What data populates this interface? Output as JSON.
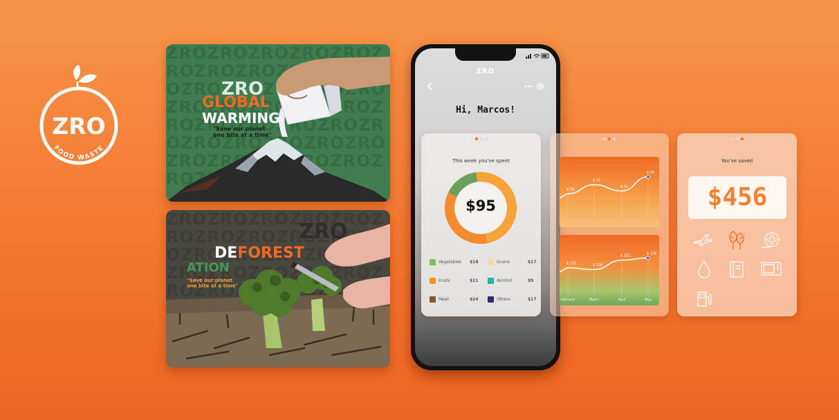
{
  "logo": {
    "brand": "ZRO",
    "tagline": "FOOD WASTE",
    "colors": {
      "ring": "#ffffff",
      "background": "#f4782e"
    }
  },
  "posters": [
    {
      "id": "global-warming",
      "brand": "ZRO",
      "title_line1": "GLOBAL",
      "title_line2": "WARMING",
      "slogan_line1": "\"Save our planet",
      "slogan_line2": "one bite at a time\"",
      "watermark": "ZROZROZROZROZROZROZROZROZROZROZROZROZROZROZROZROZROZROZROZROZROZROZROZROZROZROZROZROZROZROZROZROZROZROZROZROZROZROZRO",
      "colors": {
        "background": "#3f7d4f",
        "accent": "#f06a24"
      }
    },
    {
      "id": "deforestation",
      "brand": "ZRO",
      "title_line1": "DEFOREST",
      "title_line2": "ATION",
      "slogan_line1": "\"Save our planet",
      "slogan_line2": "one bite at a time\"",
      "watermark": "ZROZROZROZROZROZROZROZROZROZROZROZROZROZROZROZROZROZROZROZROZROZROZROZROZROZROZROZROZROZROZROZROZROZROZROZROZROZROZRO",
      "colors": {
        "background": "#4a4640",
        "accent": "#f06a24",
        "accent2": "#3f9a5a"
      }
    }
  ],
  "phone": {
    "brand": "ZRO",
    "greeting": "Hi, Marcos!",
    "icons": [
      "back-chevron-icon",
      "more-dots-icon",
      "settings-gear-icon",
      "signal-icon",
      "wifi-icon",
      "battery-icon"
    ]
  },
  "spent_card": {
    "label": "This week you've spent",
    "total": "$95",
    "categories": [
      {
        "name": "Vegetables",
        "amount": "$18",
        "color": "#7fc14a"
      },
      {
        "name": "Grains",
        "amount": "$17",
        "color": "#f6d9a8"
      },
      {
        "name": "Fruits",
        "amount": "$11",
        "color": "#f7941d"
      },
      {
        "name": "Alcohol",
        "amount": "$9",
        "color": "#2bb1a4"
      },
      {
        "name": "Meat",
        "amount": "$24",
        "color": "#8a5424"
      },
      {
        "name": "Others",
        "amount": "$17",
        "color": "#2a2a6e"
      }
    ],
    "donut": [
      {
        "share": 0.16,
        "color": "#6da05a"
      },
      {
        "share": 0.49,
        "color": "#f7a33a"
      },
      {
        "share": 0.35,
        "color": "#f58a2e"
      }
    ]
  },
  "chart_data": [
    {
      "type": "line",
      "x": [
        "",
        "",
        "",
        ""
      ],
      "values": [
        54,
        76,
        61,
        95
      ],
      "labels": [
        "$ 54",
        "$ 76",
        "$ 61",
        "$ 95"
      ],
      "ylim": [
        40,
        100
      ]
    },
    {
      "type": "line",
      "x": [
        "February",
        "March",
        "April",
        "May"
      ],
      "values": [
        220,
        198,
        311,
        338
      ],
      "labels": [
        "$ 220",
        "$ 198",
        "$ 311",
        "$ 338"
      ],
      "ylim": [
        100,
        400
      ]
    }
  ],
  "saved_card": {
    "label": "You've saved",
    "amount": "$456",
    "icons": [
      "airplane-icon",
      "trees-icon",
      "film-reel-icon",
      "water-drop-icon",
      "book-icon",
      "microwave-icon",
      "fuel-pump-icon"
    ]
  }
}
